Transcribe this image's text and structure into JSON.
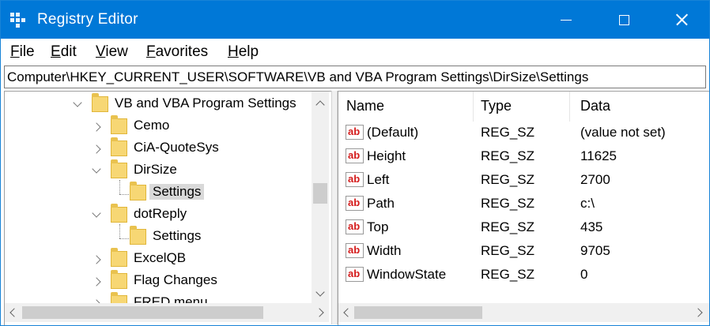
{
  "window": {
    "title": "Registry Editor"
  },
  "menu": [
    "File",
    "Edit",
    "View",
    "Favorites",
    "Help"
  ],
  "address": "Computer\\HKEY_CURRENT_USER\\SOFTWARE\\VB and VBA Program Settings\\DirSize\\Settings",
  "tree": [
    {
      "label": "VB and VBA Program Settings",
      "chevron": "down"
    },
    {
      "label": "Cemo",
      "chevron": "right"
    },
    {
      "label": "CiA-QuoteSys",
      "chevron": "right"
    },
    {
      "label": "DirSize",
      "chevron": "down"
    },
    {
      "label": "Settings",
      "chevron": ""
    },
    {
      "label": "dotReply",
      "chevron": "down"
    },
    {
      "label": "Settings",
      "chevron": ""
    },
    {
      "label": "ExcelQB",
      "chevron": "right"
    },
    {
      "label": "Flag Changes",
      "chevron": "right"
    },
    {
      "label": "FRED menu",
      "chevron": "right"
    }
  ],
  "list": {
    "columns": [
      "Name",
      "Type",
      "Data"
    ],
    "rows": [
      {
        "name": "(Default)",
        "type": "REG_SZ",
        "data": "(value not set)"
      },
      {
        "name": "Height",
        "type": "REG_SZ",
        "data": "11625"
      },
      {
        "name": "Left",
        "type": "REG_SZ",
        "data": "2700"
      },
      {
        "name": "Path",
        "type": "REG_SZ",
        "data": "c:\\"
      },
      {
        "name": "Top",
        "type": "REG_SZ",
        "data": "435"
      },
      {
        "name": "Width",
        "type": "REG_SZ",
        "data": "9705"
      },
      {
        "name": "WindowState",
        "type": "REG_SZ",
        "data": "0"
      }
    ]
  },
  "colors": {
    "titlebar": "#0078d7",
    "folder": "#f7d774",
    "selection": "#d9d9d9",
    "string_icon": "#d41b1b"
  }
}
